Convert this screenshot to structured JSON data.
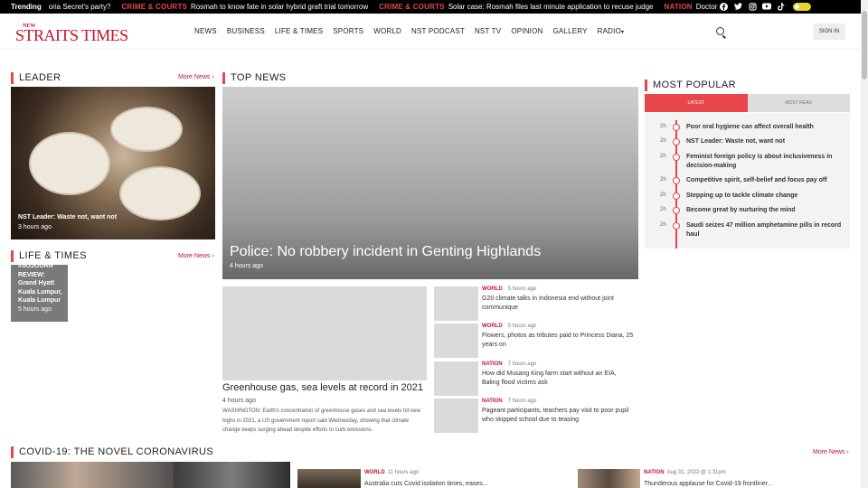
{
  "trending": {
    "label": "Trending",
    "items": [
      {
        "category": "",
        "text": "oria Secret's party?"
      },
      {
        "category": "CRIME & COURTS",
        "text": "Rosmah to know fate in solar hybrid graft trial tomorrow"
      },
      {
        "category": "CRIME & COURTS",
        "text": "Solar case: Rosmah files last minute application to recuse judge"
      },
      {
        "category": "NATION",
        "text": "Doctor"
      }
    ],
    "social_icons": [
      "facebook-icon",
      "twitter-icon",
      "instagram-icon",
      "youtube-icon",
      "tiktok-icon"
    ]
  },
  "header": {
    "logo_small": "NEW",
    "logo_main": "STRAITS TIMES",
    "nav": [
      "NEWS",
      "BUSINESS",
      "LIFE & TIMES",
      "SPORTS",
      "WORLD",
      "NST PODCAST",
      "NST TV",
      "OPINION",
      "GALLERY",
      "RADIO"
    ],
    "sign_in": "SIGN IN"
  },
  "leader": {
    "title": "LEADER",
    "more": "More News ›",
    "headline": "NST Leader: Waste not, want not",
    "time": "3 hours ago"
  },
  "top_news": {
    "title": "TOP NEWS",
    "headline": "Police: No robbery incident in Genting Highlands",
    "time": "4 hours ago",
    "secondary": {
      "headline": "Greenhouse gas, sea levels at record in 2021",
      "time": "4 hours ago",
      "summary": "WASHINGTON: Earth's concentration of greenhouse gases and sea levels hit new highs in 2021, a US government report said Wednesday, showing that climate change keeps surging ahead despite efforts to curb emissions."
    },
    "items": [
      {
        "category": "WORLD",
        "time": "5 hours ago",
        "headline": "G20 climate talks in Indonesia end without joint communique"
      },
      {
        "category": "WORLD",
        "time": "5 hours ago",
        "headline": "Flowers, photos as tributes paid to Princess Diana, 25 years on"
      },
      {
        "category": "NATION",
        "time": "7 hours ago",
        "headline": "How did Musang King farm start without an EIA, Baling flood victims ask"
      },
      {
        "category": "NATION",
        "time": "7 hours ago",
        "headline": "Pageant participants, teachers pay visit to poor pupil who skipped school due to teasing"
      }
    ]
  },
  "life_times": {
    "title": "LIFE & TIMES",
    "more": "More News ›",
    "headline": "#SOJOURN REVIEW: Grand Hyatt Kuala Lumpur, Kuala Lumpur",
    "time": "5 hours ago"
  },
  "most_popular": {
    "title": "MOST POPULAR",
    "tabs": [
      "LATEST",
      "MOST READ"
    ],
    "items": [
      {
        "time": "2h",
        "headline": "Poor oral hygiene can affect overall health"
      },
      {
        "time": "2h",
        "headline": "NST Leader: Waste not, want not"
      },
      {
        "time": "2h",
        "headline": "Feminist foreign policy is about inclusiveness in decision-making"
      },
      {
        "time": "2h",
        "headline": "Competitive spirit, self-belief and focus pay off"
      },
      {
        "time": "2h",
        "headline": "Stepping up to tackle climate change"
      },
      {
        "time": "2h",
        "headline": "Become great by nurturing the mind"
      },
      {
        "time": "2h",
        "headline": "Saudi seizes 47 million amphetamine pills in record haul"
      }
    ]
  },
  "covid": {
    "title": "COVID-19: THE NOVEL CORONAVIRUS",
    "more": "More News ›",
    "items": [
      {
        "category": "WORLD",
        "time": "11 hours ago",
        "headline": "Australia cuts Covid isolation times, eases..."
      },
      {
        "category": "NATION",
        "time": "Aug 31, 2022 @ 1:31pm",
        "headline": "Thunderous applause for Covid-19 frontliner..."
      }
    ]
  },
  "colors": {
    "accent": "#e8464b",
    "brand": "#c3122f"
  }
}
